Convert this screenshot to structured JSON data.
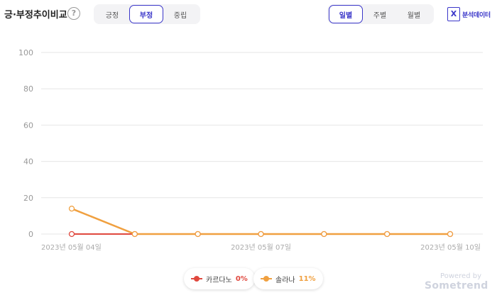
{
  "header": {
    "title": "긍·부정추이비교",
    "help_glyph": "?",
    "sentiment_tabs": [
      {
        "label": "긍정",
        "active": false
      },
      {
        "label": "부정",
        "active": true
      },
      {
        "label": "중립",
        "active": false
      }
    ],
    "period_tabs": [
      {
        "label": "일별",
        "active": true
      },
      {
        "label": "주별",
        "active": false
      },
      {
        "label": "월별",
        "active": false
      }
    ],
    "export_icon_glyph": "X",
    "export_label": "분석데이터"
  },
  "colors": {
    "accent": "#3a36c9",
    "series_1": "#e0483e",
    "series_2": "#f0a040",
    "grid": "#e6e6e6"
  },
  "chart_data": {
    "type": "line",
    "x": [
      "2023-05-04",
      "2023-05-05",
      "2023-05-06",
      "2023-05-07",
      "2023-05-08",
      "2023-05-09",
      "2023-05-10"
    ],
    "x_tick_labels": [
      "2023년 05월 04일",
      "2023년 05월 07일",
      "2023년 05월 10일"
    ],
    "x_tick_index": [
      0,
      3,
      6
    ],
    "ylim": [
      0,
      100
    ],
    "yticks": [
      0,
      20,
      40,
      60,
      80,
      100
    ],
    "grid": true,
    "legend_position": "bottom",
    "series": [
      {
        "name": "카르다노",
        "percent_label": "0%",
        "color": "#e0483e",
        "values": [
          0,
          0,
          0,
          0,
          0,
          0,
          0
        ]
      },
      {
        "name": "솔라나",
        "percent_label": "11%",
        "color": "#f0a040",
        "values": [
          14,
          0,
          0,
          0,
          0,
          0,
          0
        ]
      }
    ]
  },
  "footer": {
    "powered_by": "Powered by",
    "brand": "Sometrend"
  }
}
